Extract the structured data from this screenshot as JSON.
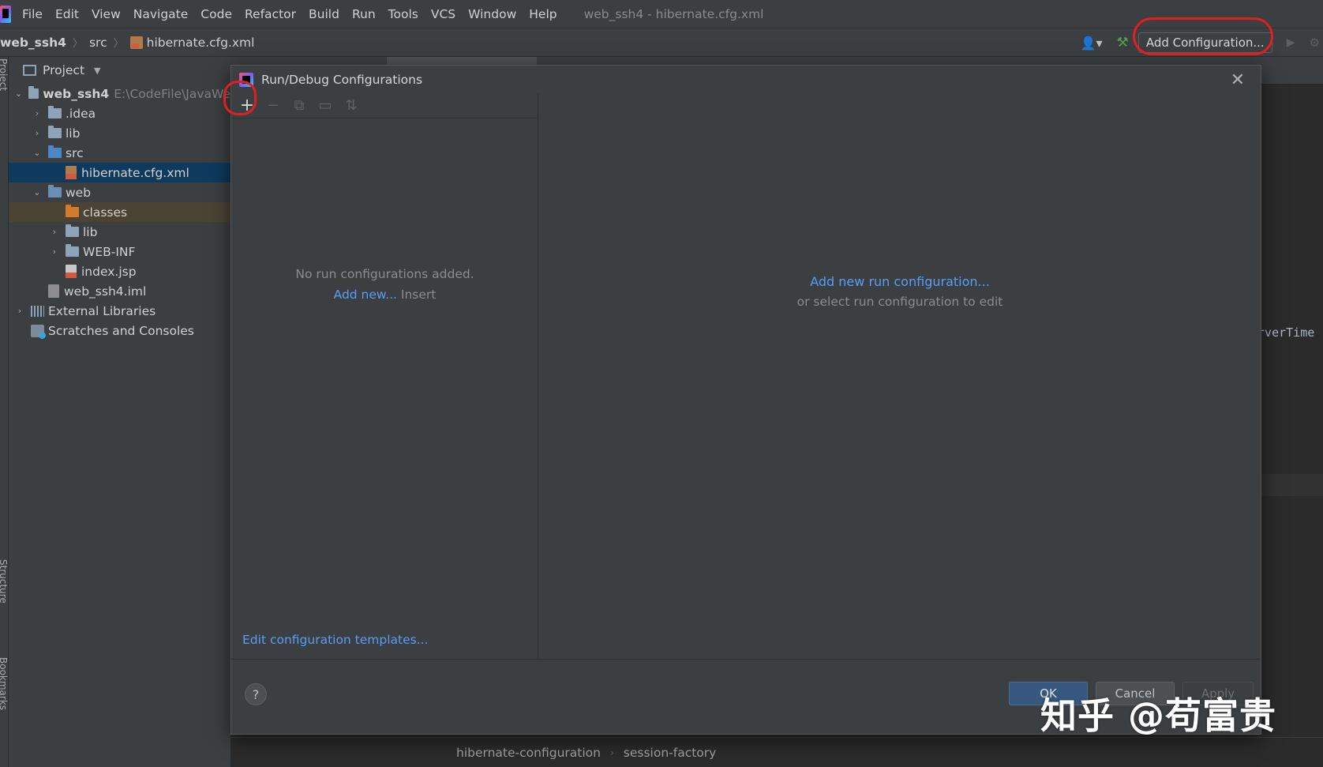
{
  "menubar": {
    "items": [
      "File",
      "Edit",
      "View",
      "Navigate",
      "Code",
      "Refactor",
      "Build",
      "Run",
      "Tools",
      "VCS",
      "Window",
      "Help"
    ],
    "window_title": "web_ssh4 - hibernate.cfg.xml"
  },
  "navbar": {
    "project": "web_ssh4",
    "folder": "src",
    "file": "hibernate.cfg.xml",
    "add_config_label": "Add Configuration..."
  },
  "side_strip": {
    "project": "Project",
    "structure": "Structure",
    "bookmarks": "Bookmarks"
  },
  "project_panel": {
    "title": "Project",
    "tree": [
      {
        "label": "web_ssh4",
        "hint": "E:\\CodeFile\\JavaWe",
        "depth": 0,
        "expanded": true,
        "icon": "module-folder-icon"
      },
      {
        "label": ".idea",
        "depth": 1,
        "expanded": false,
        "icon": "folder-icon"
      },
      {
        "label": "lib",
        "depth": 1,
        "expanded": false,
        "icon": "folder-icon"
      },
      {
        "label": "src",
        "depth": 1,
        "expanded": true,
        "icon": "source-folder-icon"
      },
      {
        "label": "hibernate.cfg.xml",
        "depth": 2,
        "icon": "xml-file-icon",
        "selected": true
      },
      {
        "label": "web",
        "depth": 1,
        "expanded": true,
        "icon": "web-folder-icon"
      },
      {
        "label": "classes",
        "depth": 2,
        "icon": "excluded-folder-icon",
        "highlighted": true
      },
      {
        "label": "lib",
        "depth": 2,
        "expanded": false,
        "icon": "folder-icon"
      },
      {
        "label": "WEB-INF",
        "depth": 2,
        "expanded": false,
        "icon": "folder-icon"
      },
      {
        "label": "index.jsp",
        "depth": 2,
        "icon": "jsp-file-icon"
      },
      {
        "label": "web_ssh4.iml",
        "depth": 1,
        "icon": "iml-file-icon"
      },
      {
        "label": "External Libraries",
        "depth": 0,
        "expanded": false,
        "icon": "library-icon"
      },
      {
        "label": "Scratches and Consoles",
        "depth": 0,
        "icon": "scratch-icon"
      }
    ]
  },
  "editor": {
    "visible_code": "erverTime",
    "breadcrumb": [
      "hibernate-configuration",
      "session-factory"
    ]
  },
  "dialog": {
    "title": "Run/Debug Configurations",
    "empty_message": "No run configurations added.",
    "add_new_link": "Add new...",
    "add_new_shortcut": "Insert",
    "templates_link": "Edit configuration templates...",
    "right_link": "Add new run configuration...",
    "right_sub": "or select run configuration to edit",
    "help_label": "?",
    "ok_label": "OK",
    "cancel_label": "Cancel",
    "apply_label": "Apply"
  },
  "watermark": "知乎 @苟富贵",
  "colors": {
    "accent_link": "#589df6",
    "annotation_red": "#e02020",
    "selection": "#0d3a5d"
  }
}
